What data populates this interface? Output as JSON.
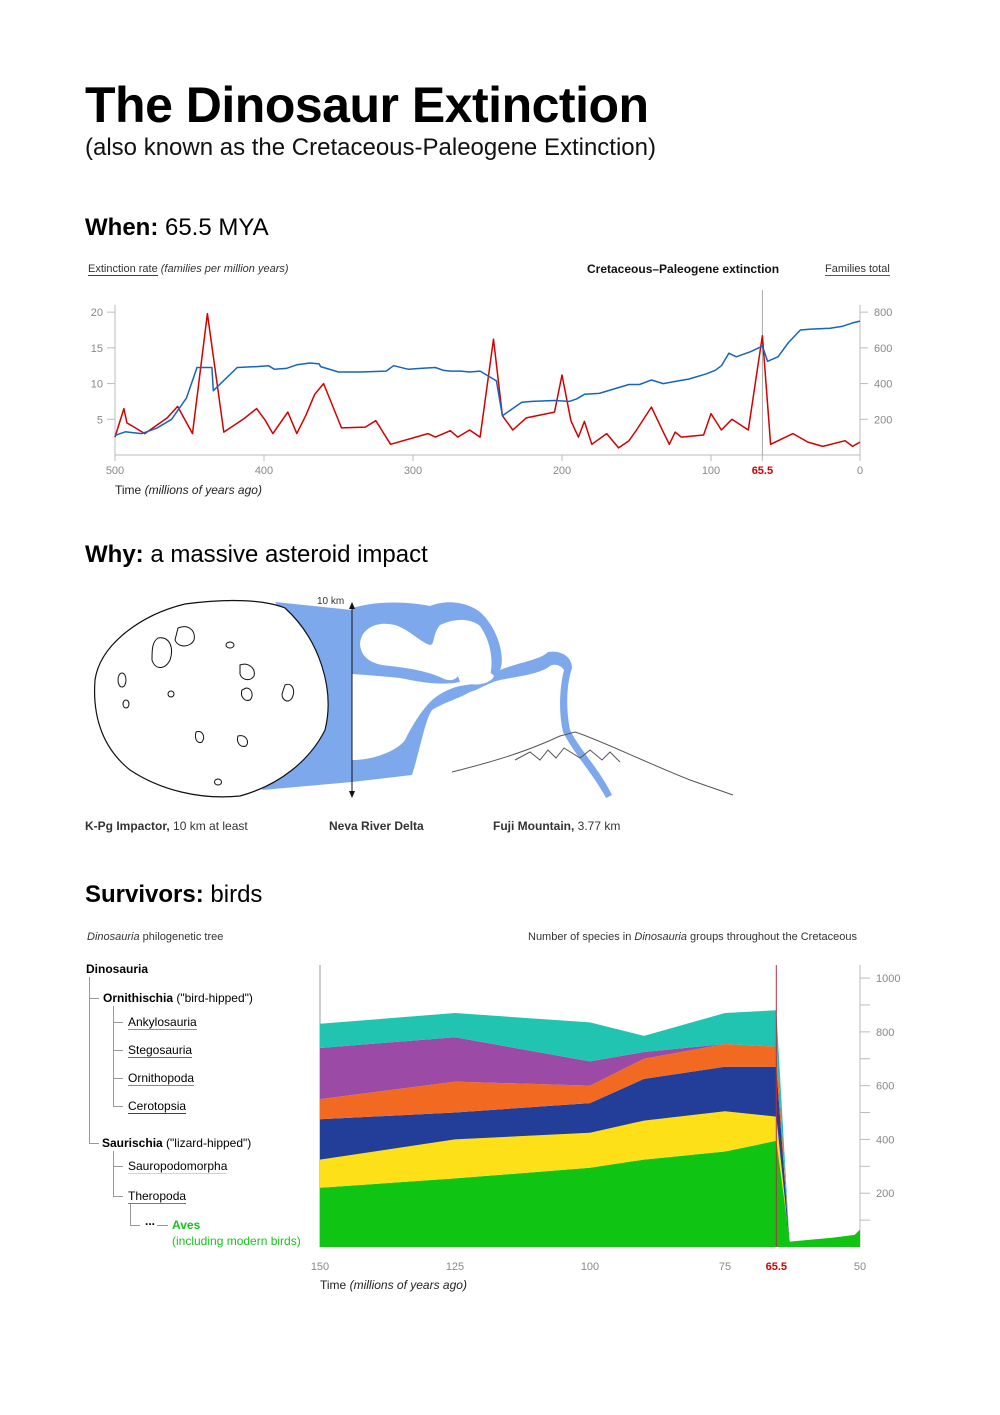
{
  "header": {
    "title": "The Dinosaur Extinction",
    "subtitle": "(also known as the Cretaceous-Paleogene Extinction)"
  },
  "when": {
    "label": "When:",
    "value": "65.5 MYA"
  },
  "why": {
    "label": "Why:",
    "value": "a massive asteroid impact",
    "scale_label": "10 km",
    "captions": {
      "impactor_bold": "K-Pg Impactor,",
      "impactor_rest": "10 km at least",
      "river": "Neva River Delta",
      "fuji_bold": "Fuji Mountain,",
      "fuji_rest": "3.77 km"
    }
  },
  "survivors": {
    "label": "Survivors:",
    "value": "birds",
    "tree_caption_italic": "Dinosauria",
    "tree_caption_rest": "philogenetic tree",
    "chart_caption_pre": "Number of species in",
    "chart_caption_italic": "Dinosauria",
    "chart_caption_post": "groups throughout the Cretaceous",
    "tree": {
      "root": "Dinosauria",
      "ornithischia": "Ornithischia",
      "ornithischia_note": "(\"bird-hipped\")",
      "ankylosauria": "Ankylosauria",
      "stegosauria": "Stegosauria",
      "ornithopoda": "Ornithopoda",
      "cerotopsia": "Cerotopsia",
      "saurischia": "Saurischia",
      "saurischia_note": "(\"lizard-hipped\")",
      "sauropodomorpha": "Sauropodomorpha",
      "theropoda": "Theropoda",
      "ellipsis": "...",
      "aves": "Aves",
      "aves_note": "(including modern birds)"
    }
  },
  "colors": {
    "extinction_rate": "#d40000",
    "families_total": "#1565c0",
    "impactor_fill": "#7ea8ec",
    "ankylosauria": "#20c4b0",
    "stegosauria": "#9b4aa5",
    "ornithopoda": "#f26a21",
    "cerotopsia": "#223e99",
    "sauropodomorpha": "#fde018",
    "theropoda": "#10c414",
    "aves_text": "#19c21d",
    "highlight": "#cc0000"
  },
  "chart_data": [
    {
      "type": "line",
      "title": "Cretaceous–Paleogene extinction",
      "xlabel": "Time",
      "xlabel_note": "(millions of years ago)",
      "xlim": [
        500,
        0
      ],
      "x_ticks": [
        "500",
        "400",
        "300",
        "200",
        "100",
        "65.5",
        "0"
      ],
      "x_tick_values": [
        500,
        400,
        300,
        200,
        100,
        65.5,
        0
      ],
      "marker": 65.5,
      "left_axis": {
        "label": "Extinction rate",
        "label_note": "(families per million years)",
        "ylim": [
          0,
          21
        ],
        "ticks": [
          "5",
          "10",
          "15",
          "20"
        ],
        "tick_values": [
          5,
          10,
          15,
          20
        ]
      },
      "right_axis": {
        "label": "Families total",
        "ylim": [
          0,
          840
        ],
        "ticks": [
          "200",
          "400",
          "600",
          "800"
        ],
        "tick_values": [
          200,
          400,
          600,
          800
        ]
      },
      "series": [
        {
          "name": "Extinction rate",
          "axis": "left",
          "points": [
            [
              500,
              2.5
            ],
            [
              494,
              6.5
            ],
            [
              492,
              4.5
            ],
            [
              488,
              4
            ],
            [
              480,
              3
            ],
            [
              465,
              5.2
            ],
            [
              458,
              6.8
            ],
            [
              448,
              3
            ],
            [
              438,
              19.8
            ],
            [
              427,
              3.2
            ],
            [
              414,
              5
            ],
            [
              405,
              6.5
            ],
            [
              399,
              4.8
            ],
            [
              394,
              3
            ],
            [
              384,
              6
            ],
            [
              378,
              3
            ],
            [
              372,
              5.5
            ],
            [
              366,
              8.5
            ],
            [
              360,
              10
            ],
            [
              348,
              3.8
            ],
            [
              332,
              3.9
            ],
            [
              325,
              4.8
            ],
            [
              315,
              1.5
            ],
            [
              290,
              3
            ],
            [
              285,
              2.5
            ],
            [
              275,
              3.4
            ],
            [
              270,
              2.5
            ],
            [
              262,
              3.5
            ],
            [
              255,
              2.5
            ],
            [
              246,
              16.2
            ],
            [
              240,
              5.5
            ],
            [
              233,
              3.5
            ],
            [
              224,
              5.2
            ],
            [
              205,
              6
            ],
            [
              200,
              11.2
            ],
            [
              194,
              4.8
            ],
            [
              189,
              2.5
            ],
            [
              185,
              4.7
            ],
            [
              180,
              1.5
            ],
            [
              170,
              3
            ],
            [
              162,
              1
            ],
            [
              155,
              2
            ],
            [
              150,
              3.5
            ],
            [
              140,
              6.7
            ],
            [
              132,
              3.2
            ],
            [
              128,
              1.5
            ],
            [
              124,
              3.2
            ],
            [
              120,
              2.5
            ],
            [
              105,
              2.8
            ],
            [
              100,
              5.8
            ],
            [
              93,
              3.5
            ],
            [
              86,
              5
            ],
            [
              75,
              3.5
            ],
            [
              65.5,
              16.7
            ],
            [
              60,
              1.5
            ],
            [
              45,
              3
            ],
            [
              35,
              1.8
            ],
            [
              25,
              1.2
            ],
            [
              10,
              2
            ],
            [
              5,
              1.2
            ],
            [
              0,
              1.8
            ]
          ]
        },
        {
          "name": "Families total",
          "axis": "right",
          "points": [
            [
              500,
              110
            ],
            [
              493,
              130
            ],
            [
              482,
              120
            ],
            [
              472,
              150
            ],
            [
              462,
              200
            ],
            [
              452,
              320
            ],
            [
              445,
              490
            ],
            [
              435,
              490
            ],
            [
              434,
              360
            ],
            [
              418,
              490
            ],
            [
              405,
              495
            ],
            [
              397,
              500
            ],
            [
              393,
              480
            ],
            [
              385,
              485
            ],
            [
              378,
              505
            ],
            [
              369,
              515
            ],
            [
              363,
              510
            ],
            [
              362,
              495
            ],
            [
              350,
              465
            ],
            [
              335,
              465
            ],
            [
              318,
              470
            ],
            [
              313,
              500
            ],
            [
              303,
              480
            ],
            [
              295,
              485
            ],
            [
              285,
              490
            ],
            [
              280,
              475
            ],
            [
              275,
              470
            ],
            [
              268,
              470
            ],
            [
              262,
              465
            ],
            [
              255,
              470
            ],
            [
              244,
              415
            ],
            [
              240,
              220
            ],
            [
              227,
              295
            ],
            [
              220,
              300
            ],
            [
              205,
              305
            ],
            [
              195,
              300
            ],
            [
              190,
              315
            ],
            [
              185,
              340
            ],
            [
              175,
              345
            ],
            [
              165,
              370
            ],
            [
              155,
              395
            ],
            [
              148,
              395
            ],
            [
              140,
              420
            ],
            [
              132,
              400
            ],
            [
              122,
              415
            ],
            [
              115,
              425
            ],
            [
              103,
              455
            ],
            [
              97,
              475
            ],
            [
              93,
              500
            ],
            [
              88,
              570
            ],
            [
              83,
              550
            ],
            [
              73,
              580
            ],
            [
              65.5,
              610
            ],
            [
              62,
              525
            ],
            [
              55,
              550
            ],
            [
              48,
              630
            ],
            [
              40,
              700
            ],
            [
              33,
              705
            ],
            [
              20,
              710
            ],
            [
              12,
              720
            ],
            [
              5,
              740
            ],
            [
              0,
              750
            ]
          ]
        }
      ]
    },
    {
      "type": "area",
      "title": "Number of species in Dinosauria groups throughout the Cretaceous",
      "xlabel": "Time",
      "xlabel_note": "(millions of years ago)",
      "xlim": [
        150,
        50
      ],
      "x_ticks": [
        "150",
        "125",
        "100",
        "75",
        "65.5",
        "50"
      ],
      "x_tick_values": [
        150,
        125,
        100,
        75,
        65.5,
        50
      ],
      "marker": 65.5,
      "ylim": [
        0,
        1030
      ],
      "y_ticks": [
        "200",
        "400",
        "600",
        "800",
        "1000"
      ],
      "y_tick_values": [
        200,
        400,
        600,
        800,
        1000
      ],
      "stacked": true,
      "x": [
        150,
        125,
        100,
        90,
        75,
        65.5
      ],
      "series": [
        {
          "name": "Theropoda",
          "color_key": "theropoda",
          "values": [
            220,
            255,
            295,
            325,
            355,
            395
          ]
        },
        {
          "name": "Sauropodomorpha",
          "color_key": "sauropodomorpha",
          "values": [
            105,
            145,
            130,
            145,
            150,
            90
          ]
        },
        {
          "name": "Cerotopsia",
          "color_key": "cerotopsia",
          "values": [
            150,
            100,
            110,
            155,
            165,
            185
          ]
        },
        {
          "name": "Ornithopoda",
          "color_key": "ornithopoda",
          "values": [
            75,
            115,
            65,
            75,
            85,
            75
          ]
        },
        {
          "name": "Stegosauria",
          "color_key": "stegosauria",
          "values": [
            190,
            165,
            90,
            25,
            0,
            0
          ]
        },
        {
          "name": "Ankylosauria",
          "color_key": "ankylosauria",
          "values": [
            90,
            90,
            145,
            60,
            115,
            135
          ]
        }
      ],
      "aves_after": [
        [
          63,
          20
        ],
        [
          55,
          35
        ],
        [
          51,
          45
        ],
        [
          50,
          65
        ]
      ]
    }
  ]
}
